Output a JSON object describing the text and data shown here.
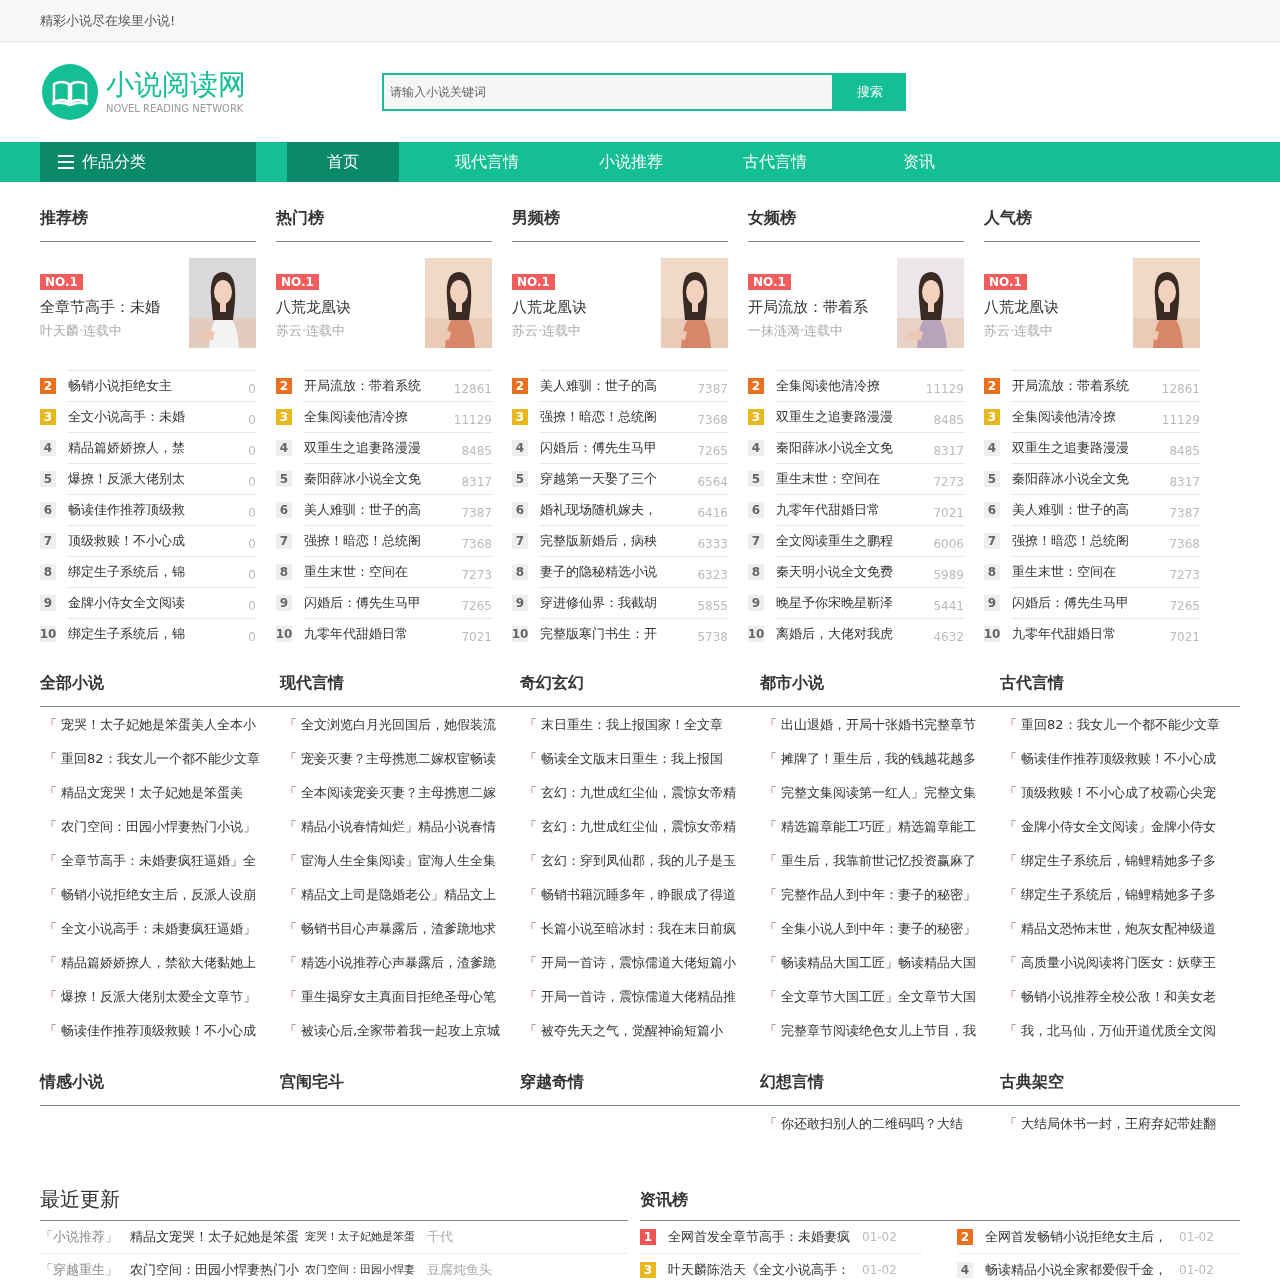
{
  "top_bar": {
    "slogan": "精彩小说尽在埃里小说!"
  },
  "header": {
    "logo": {
      "name": "小说阅读网",
      "subtitle": "NOVEL READING NETWORK"
    },
    "search": {
      "placeholder": "请输入小说关键词",
      "button": "搜索"
    }
  },
  "nav": {
    "category_menu": "作品分类",
    "items": [
      {
        "label": "首页",
        "selected": true
      },
      {
        "label": "现代言情",
        "selected": false
      },
      {
        "label": "小说推荐",
        "selected": false
      },
      {
        "label": "古代言情",
        "selected": false
      },
      {
        "label": "资讯",
        "selected": false
      }
    ]
  },
  "rankings": [
    {
      "title": "推荐榜",
      "top": {
        "badge": "NO.1",
        "title": "全章节高手：未婚",
        "meta": "叶天麟·连载中"
      },
      "items": [
        {
          "rank": "2",
          "title": "畅销小说拒绝女主",
          "count": "0",
          "color": "#e8701e"
        },
        {
          "rank": "3",
          "title": "全文小说高手：未婚",
          "count": "0",
          "color": "#e8b81e"
        },
        {
          "rank": "4",
          "title": "精品篇娇娇撩人，禁",
          "count": "0"
        },
        {
          "rank": "5",
          "title": "爆撩！反派大佬别太",
          "count": "0"
        },
        {
          "rank": "6",
          "title": "畅读佳作推荐顶级救",
          "count": "0"
        },
        {
          "rank": "7",
          "title": "顶级救赎！不小心成",
          "count": "0"
        },
        {
          "rank": "8",
          "title": "绑定生子系统后，锦",
          "count": "0"
        },
        {
          "rank": "9",
          "title": "金牌小侍女全文阅读",
          "count": "0"
        },
        {
          "rank": "10",
          "title": "绑定生子系统后，锦",
          "count": "0"
        }
      ]
    },
    {
      "title": "热门榜",
      "top": {
        "badge": "NO.1",
        "title": "八荒龙凰诀",
        "meta": "苏云·连载中"
      },
      "items": [
        {
          "rank": "2",
          "title": "开局流放：带着系统",
          "count": "12861",
          "color": "#e8701e"
        },
        {
          "rank": "3",
          "title": "全集阅读他清冷撩",
          "count": "11129",
          "color": "#e8b81e"
        },
        {
          "rank": "4",
          "title": "双重生之追妻路漫漫",
          "count": "8485"
        },
        {
          "rank": "5",
          "title": "秦阳薛冰小说全文免",
          "count": "8317"
        },
        {
          "rank": "6",
          "title": "美人难驯：世子的高",
          "count": "7387"
        },
        {
          "rank": "7",
          "title": "强撩！暗恋！总统阁",
          "count": "7368"
        },
        {
          "rank": "8",
          "title": "重生末世：空间在",
          "count": "7273"
        },
        {
          "rank": "9",
          "title": "闪婚后：傅先生马甲",
          "count": "7265"
        },
        {
          "rank": "10",
          "title": "九零年代甜婚日常",
          "count": "7021"
        }
      ]
    },
    {
      "title": "男频榜",
      "top": {
        "badge": "NO.1",
        "title": "八荒龙凰诀",
        "meta": "苏云·连载中"
      },
      "items": [
        {
          "rank": "2",
          "title": "美人难驯：世子的高",
          "count": "7387",
          "color": "#e8701e"
        },
        {
          "rank": "3",
          "title": "强撩！暗恋！总统阁",
          "count": "7368",
          "color": "#e8b81e"
        },
        {
          "rank": "4",
          "title": "闪婚后：傅先生马甲",
          "count": "7265"
        },
        {
          "rank": "5",
          "title": "穿越第一天娶了三个",
          "count": "6564"
        },
        {
          "rank": "6",
          "title": "婚礼现场随机嫁夫，",
          "count": "6416"
        },
        {
          "rank": "7",
          "title": "完整版新婚后，病秧",
          "count": "6333"
        },
        {
          "rank": "8",
          "title": "妻子的隐秘精选小说",
          "count": "6323"
        },
        {
          "rank": "9",
          "title": "穿进修仙界：我截胡",
          "count": "5855"
        },
        {
          "rank": "10",
          "title": "完整版寒门书生：开",
          "count": "5738"
        }
      ]
    },
    {
      "title": "女频榜",
      "top": {
        "badge": "NO.1",
        "title": "开局流放：带着系",
        "meta": "一抹涟漪·连载中"
      },
      "items": [
        {
          "rank": "2",
          "title": "全集阅读他清冷撩",
          "count": "11129",
          "color": "#e8701e"
        },
        {
          "rank": "3",
          "title": "双重生之追妻路漫漫",
          "count": "8485",
          "color": "#e8b81e"
        },
        {
          "rank": "4",
          "title": "秦阳薛冰小说全文免",
          "count": "8317"
        },
        {
          "rank": "5",
          "title": "重生末世：空间在",
          "count": "7273"
        },
        {
          "rank": "6",
          "title": "九零年代甜婚日常",
          "count": "7021"
        },
        {
          "rank": "7",
          "title": "全文阅读重生之鹏程",
          "count": "6006"
        },
        {
          "rank": "8",
          "title": "秦天明小说全文免费",
          "count": "5989"
        },
        {
          "rank": "9",
          "title": "晚星予你宋晚星靳泽",
          "count": "5441"
        },
        {
          "rank": "10",
          "title": "离婚后，大佬对我虎",
          "count": "4632"
        }
      ]
    },
    {
      "title": "人气榜",
      "top": {
        "badge": "NO.1",
        "title": "八荒龙凰诀",
        "meta": "苏云·连载中"
      },
      "items": [
        {
          "rank": "2",
          "title": "开局流放：带着系统",
          "count": "12861",
          "color": "#e8701e"
        },
        {
          "rank": "3",
          "title": "全集阅读他清冷撩",
          "count": "11129",
          "color": "#e8b81e"
        },
        {
          "rank": "4",
          "title": "双重生之追妻路漫漫",
          "count": "8485"
        },
        {
          "rank": "5",
          "title": "秦阳薛冰小说全文免",
          "count": "8317"
        },
        {
          "rank": "6",
          "title": "美人难驯：世子的高",
          "count": "7387"
        },
        {
          "rank": "7",
          "title": "强撩！暗恋！总统阁",
          "count": "7368"
        },
        {
          "rank": "8",
          "title": "重生末世：空间在",
          "count": "7273"
        },
        {
          "rank": "9",
          "title": "闪婚后：傅先生马甲",
          "count": "7265"
        },
        {
          "rank": "10",
          "title": "九零年代甜婚日常",
          "count": "7021"
        }
      ]
    }
  ],
  "category_sections": [
    {
      "columns": [
        {
          "title": "全部小说",
          "items": [
            {
              "bracket": "「",
              "title": "宠哭！太子妃她是笨蛋美人全本小"
            },
            {
              "bracket": "「",
              "title": "重回82：我女儿一个都不能少文章"
            },
            {
              "bracket": "「",
              "title": "精品文宠哭！太子妃她是笨蛋美"
            },
            {
              "bracket": "「",
              "title": "农门空间：田园小悍妻热门小说」"
            },
            {
              "bracket": "「",
              "title": "全章节高手：未婚妻疯狂逼婚」全"
            },
            {
              "bracket": "「",
              "title": "畅销小说拒绝女主后，反派人设崩"
            },
            {
              "bracket": "「",
              "title": "全文小说高手：未婚妻疯狂逼婚」"
            },
            {
              "bracket": "「",
              "title": "精品篇娇娇撩人，禁欲大佬黏她上"
            },
            {
              "bracket": "「",
              "title": "爆撩！反派大佬别太爱全文章节」"
            },
            {
              "bracket": "「",
              "title": "畅读佳作推荐顶级救赎！不小心成"
            }
          ]
        },
        {
          "title": "现代言情",
          "items": [
            {
              "bracket": "「",
              "title": "全文浏览白月光回国后，她假装流"
            },
            {
              "bracket": "「",
              "title": "宠妾灭妻？主母携崽二嫁权宦畅读"
            },
            {
              "bracket": "「",
              "title": "全本阅读宠妾灭妻？主母携崽二嫁"
            },
            {
              "bracket": "「",
              "title": "精品小说春情灿烂」精品小说春情"
            },
            {
              "bracket": "「",
              "title": "宦海人生全集阅读」宦海人生全集"
            },
            {
              "bracket": "「",
              "title": "精品文上司是隐婚老公」精品文上"
            },
            {
              "bracket": "「",
              "title": "畅销书目心声暴露后，渣爹跪地求"
            },
            {
              "bracket": "「",
              "title": "精选小说推荐心声暴露后，渣爹跪"
            },
            {
              "bracket": "「",
              "title": "重生揭穿女主真面目拒绝圣母心笔"
            },
            {
              "bracket": "「",
              "title": "被读心后,全家带着我一起攻上京城"
            }
          ]
        },
        {
          "title": "奇幻玄幻",
          "items": [
            {
              "bracket": "「",
              "title": "末日重生：我上报国家！全文章"
            },
            {
              "bracket": "「",
              "title": "畅读全文版末日重生：我上报国"
            },
            {
              "bracket": "「",
              "title": "玄幻：九世成红尘仙，震惊女帝精"
            },
            {
              "bracket": "「",
              "title": "玄幻：九世成红尘仙，震惊女帝精"
            },
            {
              "bracket": "「",
              "title": "玄幻：穿到凤仙郡，我的儿子是玉"
            },
            {
              "bracket": "「",
              "title": "畅销书籍沉睡多年，睁眼成了得道"
            },
            {
              "bracket": "「",
              "title": "长篇小说至暗冰封：我在末日前疯"
            },
            {
              "bracket": "「",
              "title": "开局一首诗，震惊儒道大佬短篇小"
            },
            {
              "bracket": "「",
              "title": "开局一首诗，震惊儒道大佬精品推"
            },
            {
              "bracket": "「",
              "title": "被夺先天之气，觉醒神谕短篇小"
            }
          ]
        },
        {
          "title": "都市小说",
          "items": [
            {
              "bracket": "「",
              "title": "出山退婚，开局十张婚书完整章节"
            },
            {
              "bracket": "「",
              "title": "摊牌了！重生后，我的钱越花越多"
            },
            {
              "bracket": "「",
              "title": "完整文集阅读第一红人」完整文集"
            },
            {
              "bracket": "「",
              "title": "精选篇章能工巧匠」精选篇章能工"
            },
            {
              "bracket": "「",
              "title": "重生后，我靠前世记忆投资赢麻了"
            },
            {
              "bracket": "「",
              "title": "完整作品人到中年：妻子的秘密」"
            },
            {
              "bracket": "「",
              "title": "全集小说人到中年：妻子的秘密」"
            },
            {
              "bracket": "「",
              "title": "畅读精品大国工匠」畅读精品大国"
            },
            {
              "bracket": "「",
              "title": "全文章节大国工匠」全文章节大国"
            },
            {
              "bracket": "「",
              "title": "完整章节阅读绝色女儿上节目，我"
            }
          ]
        },
        {
          "title": "古代言情",
          "items": [
            {
              "bracket": "「",
              "title": "重回82：我女儿一个都不能少文章"
            },
            {
              "bracket": "「",
              "title": "畅读佳作推荐顶级救赎！不小心成"
            },
            {
              "bracket": "「",
              "title": "顶级救赎！不小心成了校霸心尖宠"
            },
            {
              "bracket": "「",
              "title": "金牌小侍女全文阅读」金牌小侍女"
            },
            {
              "bracket": "「",
              "title": "绑定生子系统后，锦鲤精她多子多"
            },
            {
              "bracket": "「",
              "title": "绑定生子系统后，锦鲤精她多子多"
            },
            {
              "bracket": "「",
              "title": "精品文恐怖末世，炮灰女配神级道"
            },
            {
              "bracket": "「",
              "title": "高质量小说阅读将门医女：妖孽王"
            },
            {
              "bracket": "「",
              "title": "畅销小说推荐全校公敌！和美女老"
            },
            {
              "bracket": "「",
              "title": "我，北马仙，万仙开道优质全文阅"
            }
          ]
        }
      ]
    },
    {
      "columns": [
        {
          "title": "情感小说"
        },
        {
          "title": "宫闱宅斗"
        },
        {
          "title": "穿越奇情"
        },
        {
          "title": "幻想言情",
          "items": [
            {
              "bracket": "「",
              "title": "你还敢扫别人的二维码吗？大结"
            }
          ]
        },
        {
          "title": "古典架空",
          "items": [
            {
              "bracket": "「",
              "title": "大结局休书一封，王府弃妃带娃翻"
            }
          ]
        }
      ]
    }
  ],
  "recent_updates": {
    "title": "最近更新",
    "rows": [
      {
        "category": "「小说推荐」",
        "title": "精品文宠哭！太子妃她是笨蛋",
        "subtitle": "宠哭！太子妃她是笨蛋",
        "author": "千代"
      },
      {
        "category": "「穿越重生」",
        "title": "农门空间：田园小悍妻热门小",
        "subtitle": "农门空间：田园小悍妻",
        "author": "豆腐炖鱼头"
      }
    ]
  },
  "news_ranking": {
    "title": "资讯榜",
    "items": [
      {
        "rank": "1",
        "title": "全网首发全章节高手：未婚妻疯",
        "date": "01-02",
        "color": "#f05454"
      },
      {
        "rank": "2",
        "title": "全网首发畅销小说拒绝女主后，",
        "date": "01-02",
        "color": "#e8701e"
      },
      {
        "rank": "3",
        "title": "叶天麟陈浩天《全文小说高手：",
        "date": "01-02",
        "color": "#e8b81e"
      },
      {
        "rank": "4",
        "title": "畅读精品小说全家都爱假千金，",
        "date": "01-02"
      }
    ]
  }
}
